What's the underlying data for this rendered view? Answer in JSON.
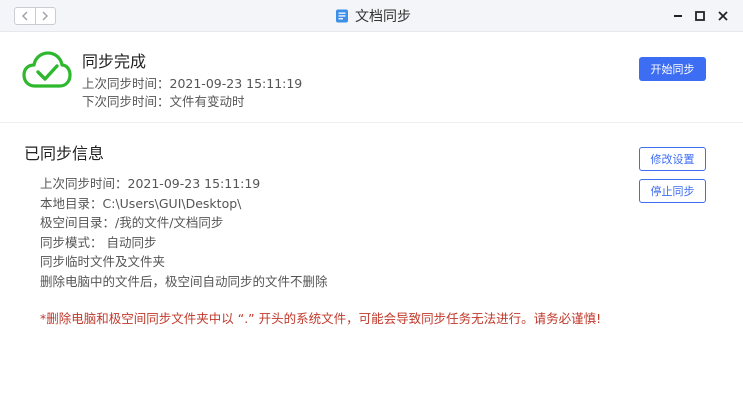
{
  "window": {
    "title": "文档同步",
    "controls": [
      "minimize-icon",
      "maximize-icon",
      "close-icon"
    ]
  },
  "nav": {
    "back_icon": "chevron-left-icon",
    "forward_icon": "chevron-right-icon"
  },
  "status": {
    "icon": "cloud-check-icon",
    "title": "同步完成",
    "last_sync": "上次同步时间：2021-09-23 15:11:19",
    "next_sync": "下次同步时间：文件有变动时",
    "start_button": "开始同步"
  },
  "info": {
    "title": "已同步信息",
    "lines": [
      "上次同步时间：2021-09-23 15:11:19",
      "本地目录：C:\\Users\\GUI\\Desktop\\",
      "极空间目录：/我的文件/文档同步",
      "同步模式： 自动同步",
      "同步临时文件及文件夹",
      "删除电脑中的文件后，极空间自动同步的文件不删除"
    ],
    "warning": "*删除电脑和极空间同步文件夹中以 “.” 开头的系统文件，可能会导致同步任务无法进行。请务必谨慎!",
    "modify_button": "修改设置",
    "stop_button": "停止同步"
  },
  "colors": {
    "accent": "#3d6df2",
    "success": "#2eb82e",
    "warning": "#c0392b"
  }
}
